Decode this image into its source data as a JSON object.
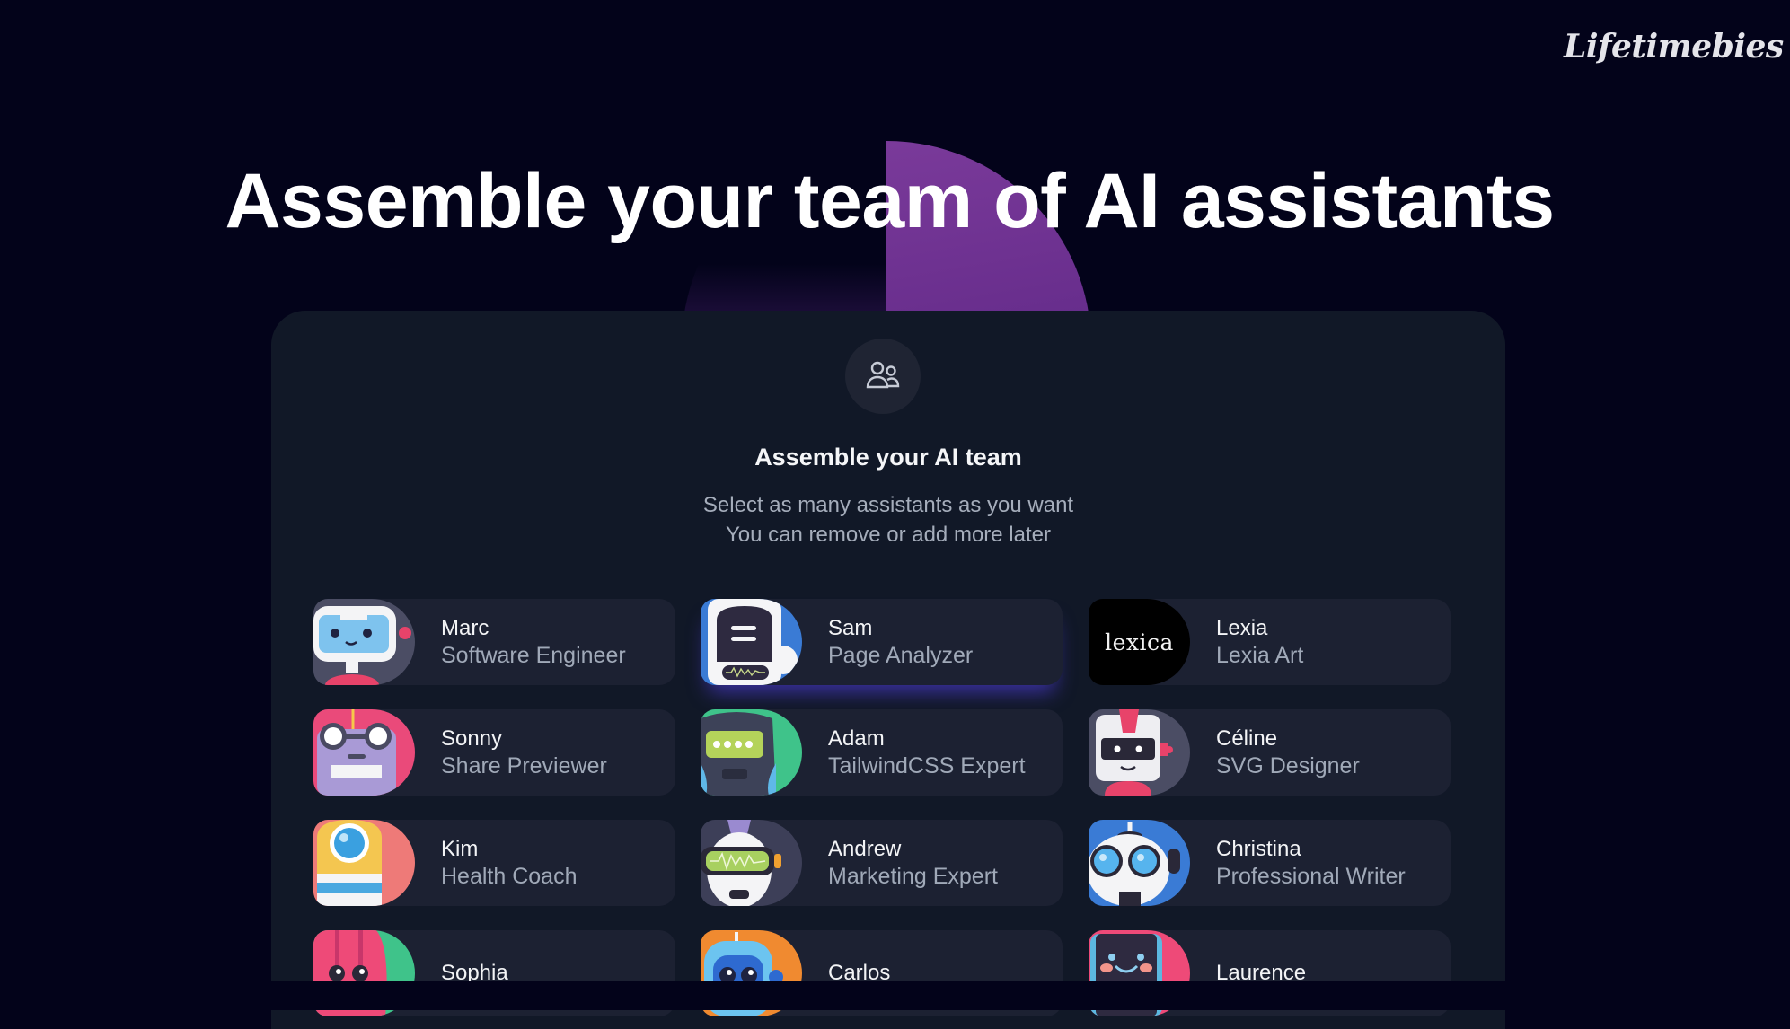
{
  "brand": {
    "name": "Lifetimebies",
    "flame_color": "#e8393a",
    "icon": "flame-logo-icon"
  },
  "hero": {
    "title": "Assemble your team of AI assistants",
    "accent_color": "#7a3a9a"
  },
  "panel": {
    "icon": "users-icon",
    "heading": "Assemble your AI team",
    "subtitle_line1": "Select as many assistants as you want",
    "subtitle_line2": "You can remove or add more later"
  },
  "assistants": [
    {
      "name": "Marc",
      "role": "Software Engineer",
      "avatar": "robot-blue-visor-avatar",
      "selected": false
    },
    {
      "name": "Sam",
      "role": "Page Analyzer",
      "avatar": "robot-dark-screen-avatar",
      "selected": true
    },
    {
      "name": "Lexia",
      "role": "Lexia Art",
      "avatar": "lexica-logo-avatar",
      "avatar_text": "lexica",
      "selected": false
    },
    {
      "name": "Sonny",
      "role": "Share Previewer",
      "avatar": "robot-goggles-avatar",
      "selected": false
    },
    {
      "name": "Adam",
      "role": "TailwindCSS Expert",
      "avatar": "robot-green-display-avatar",
      "selected": false
    },
    {
      "name": "Céline",
      "role": "SVG Designer",
      "avatar": "robot-red-crest-avatar",
      "selected": false
    },
    {
      "name": "Kim",
      "role": "Health Coach",
      "avatar": "robot-yellow-eye-avatar",
      "selected": false
    },
    {
      "name": "Andrew",
      "role": "Marketing Expert",
      "avatar": "robot-vr-headset-avatar",
      "selected": false
    },
    {
      "name": "Christina",
      "role": "Professional Writer",
      "avatar": "robot-round-eyes-avatar",
      "selected": false
    },
    {
      "name": "Sophia",
      "role": "",
      "avatar": "robot-pink-avatar",
      "selected": false
    },
    {
      "name": "Carlos",
      "role": "",
      "avatar": "robot-blue-orange-avatar",
      "selected": false
    },
    {
      "name": "Laurence",
      "role": "",
      "avatar": "robot-smiley-phone-avatar",
      "selected": false
    }
  ]
}
